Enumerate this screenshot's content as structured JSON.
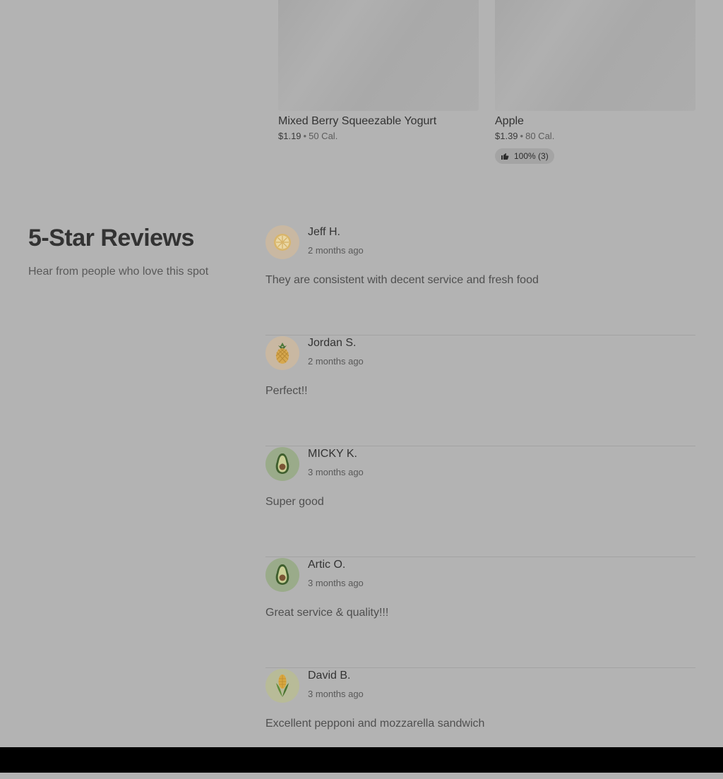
{
  "products": [
    {
      "name": "Mixed Berry Squeezable Yogurt",
      "price": "$1.19",
      "separator": "•",
      "calories": "50 Cal."
    },
    {
      "name": "Apple",
      "price": "$1.39",
      "separator": "•",
      "calories": "80 Cal.",
      "rating": "100% (3)"
    }
  ],
  "section": {
    "title": "5-Star Reviews",
    "subtitle": "Hear from people who love this spot"
  },
  "reviews": [
    {
      "name": "Jeff H.",
      "time": "2 months ago",
      "text": "They are consistent with decent service and fresh food",
      "avatar_icon": "lemon-slice-icon"
    },
    {
      "name": "Jordan S.",
      "time": "2 months ago",
      "text": "Perfect!!",
      "avatar_icon": "pineapple-icon"
    },
    {
      "name": "MICKY K.",
      "time": "3 months ago",
      "text": "Super good",
      "avatar_icon": "avocado-icon"
    },
    {
      "name": "Artic O.",
      "time": "3 months ago",
      "text": "Great service & quality!!!",
      "avatar_icon": "avocado-icon"
    },
    {
      "name": "David B.",
      "time": "3 months ago",
      "text": "Excellent pepponi and mozzarella sandwich",
      "avatar_icon": "corn-icon"
    }
  ],
  "colors": {
    "overlay_background": "#b3b3b3",
    "bottom_bar": "#000000",
    "avatar_peach": "#c9b8a2",
    "avatar_green": "#9aab8a"
  }
}
